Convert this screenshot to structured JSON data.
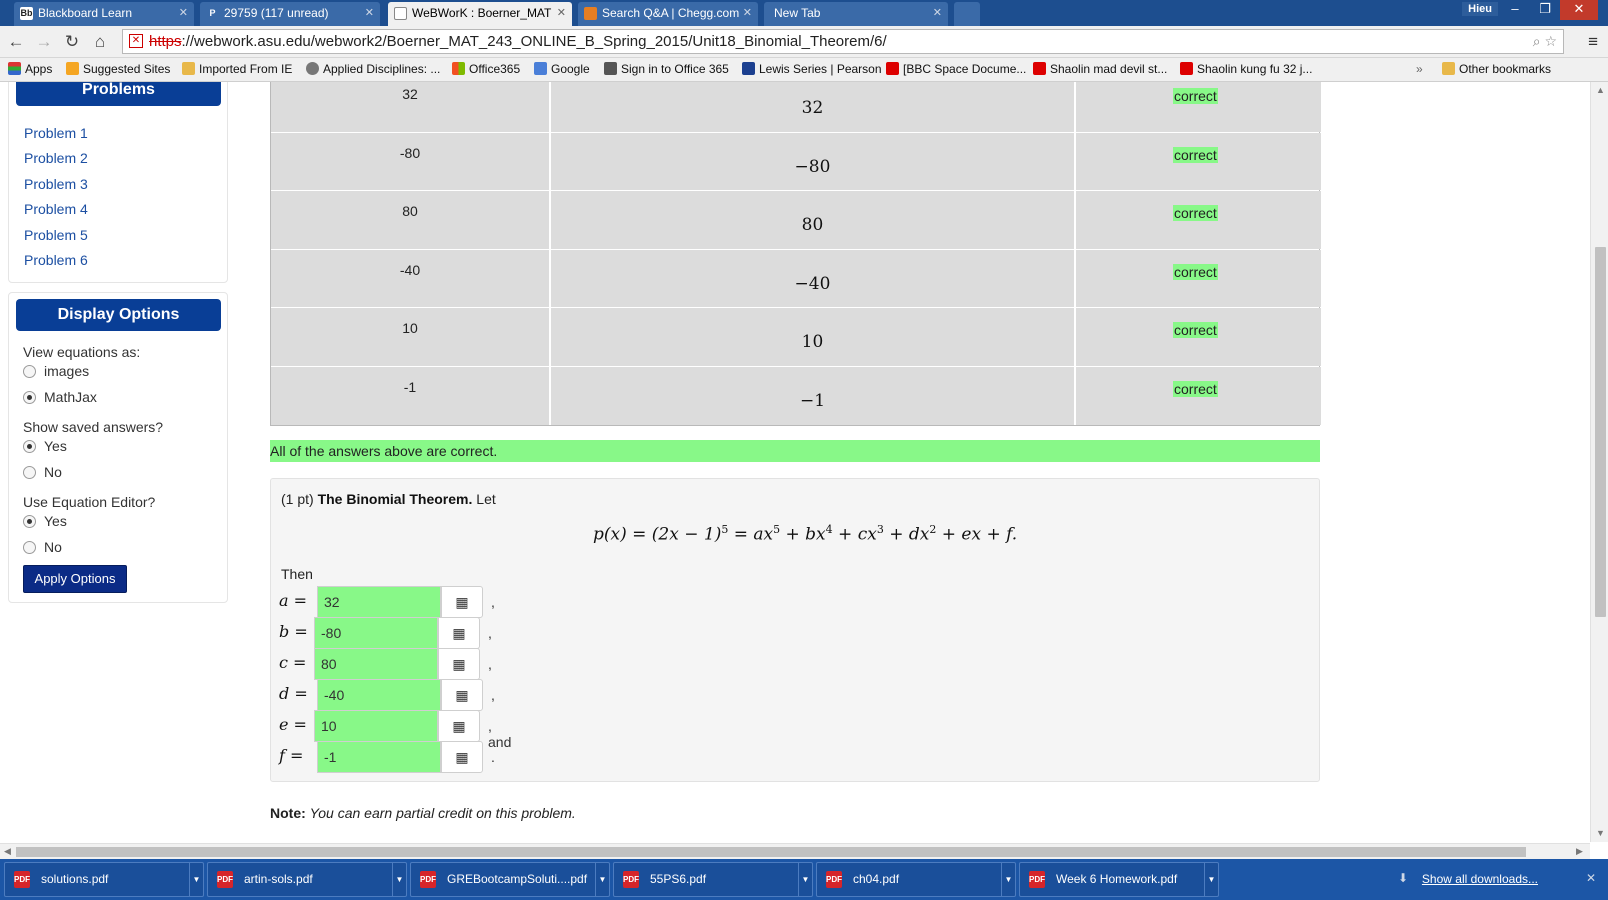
{
  "browser": {
    "tabs": [
      {
        "label": "Blackboard Learn",
        "favicon": "Bb"
      },
      {
        "label": "29759 (117 unread)",
        "favicon": "P"
      },
      {
        "label": "WeBWorK : Boerner_MAT",
        "favicon": "doc"
      },
      {
        "label": "Search Q&A | Chegg.com",
        "favicon": "chegg"
      },
      {
        "label": "New Tab",
        "favicon": ""
      }
    ],
    "user": "Hieu",
    "window_controls": [
      "–",
      "❐",
      "✕"
    ],
    "url_scheme": "https",
    "url_rest": "://webwork.asu.edu/webwork2/Boerner_MAT_243_ONLINE_B_Spring_2015/Unit18_Binomial_Theorem/6/",
    "bookmarks": [
      "Apps",
      "Suggested Sites",
      "Imported From IE",
      "Applied Disciplines: ...",
      "Office365",
      "Google",
      "Sign in to Office 365",
      "Lewis Series | Pearson",
      "[BBC Space Docume...",
      "Shaolin mad devil st...",
      "Shaolin kung fu 32 j...",
      "»",
      "Other bookmarks"
    ]
  },
  "sidebar": {
    "problems_title": "Problems",
    "problems": [
      "Problem 1",
      "Problem 2",
      "Problem 3",
      "Problem 4",
      "Problem 5",
      "Problem 6"
    ],
    "display_title": "Display Options",
    "view_equations_label": "View equations as:",
    "view_equations_options": [
      {
        "label": "images",
        "checked": false
      },
      {
        "label": "MathJax",
        "checked": true
      }
    ],
    "saved_answers_label": "Show saved answers?",
    "saved_answers_options": [
      {
        "label": "Yes",
        "checked": true
      },
      {
        "label": "No",
        "checked": false
      }
    ],
    "equation_editor_label": "Use Equation Editor?",
    "equation_editor_options": [
      {
        "label": "Yes",
        "checked": true
      },
      {
        "label": "No",
        "checked": false
      }
    ],
    "apply_label": "Apply Options"
  },
  "results": {
    "rows": [
      {
        "entered": "32",
        "preview": "32",
        "status": "correct"
      },
      {
        "entered": "-80",
        "preview": "−80",
        "status": "correct"
      },
      {
        "entered": "80",
        "preview": "80",
        "status": "correct"
      },
      {
        "entered": "-40",
        "preview": "−40",
        "status": "correct"
      },
      {
        "entered": "10",
        "preview": "10",
        "status": "correct"
      },
      {
        "entered": "-1",
        "preview": "−1",
        "status": "correct"
      }
    ],
    "summary": "All of the answers above are correct."
  },
  "problem": {
    "points": "(1 pt)",
    "title": "The Binomial Theorem.",
    "intro_tail": "Let",
    "formula_lhs": "p(x) = (2x − 1)",
    "formula_exp1": "5",
    "formula_a": " = ax",
    "formula_exp2": "5",
    "formula_b": " + bx",
    "formula_exp3": "4",
    "formula_c": " + cx",
    "formula_exp4": "3",
    "formula_d": " + dx",
    "formula_exp5": "2",
    "formula_tail": " + ex + f.",
    "then": "Then",
    "answers": [
      {
        "var": "a =",
        "value": "32",
        "after": ","
      },
      {
        "var": "b =",
        "value": "-80",
        "after": ","
      },
      {
        "var": "c =",
        "value": "80",
        "after": ","
      },
      {
        "var": "d =",
        "value": "-40",
        "after": ","
      },
      {
        "var": "e =",
        "value": "10",
        "after": ", and"
      },
      {
        "var": "f =",
        "value": "-1",
        "after": "."
      }
    ],
    "note_label": "Note:",
    "note_text": "You can earn partial credit on this problem."
  },
  "downloads": {
    "files": [
      "solutions.pdf",
      "artin-sols.pdf",
      "GREBootcampSoluti....pdf",
      "55PS6.pdf",
      "ch04.pdf",
      "Week 6 Homework.pdf"
    ],
    "show_all": "Show all downloads...",
    "close": "✕"
  },
  "colors": {
    "accent": "#093e96",
    "correct_green": "#88f888",
    "tabbar": "#1d4e8f",
    "downloads_bar": "#1c56a6"
  }
}
